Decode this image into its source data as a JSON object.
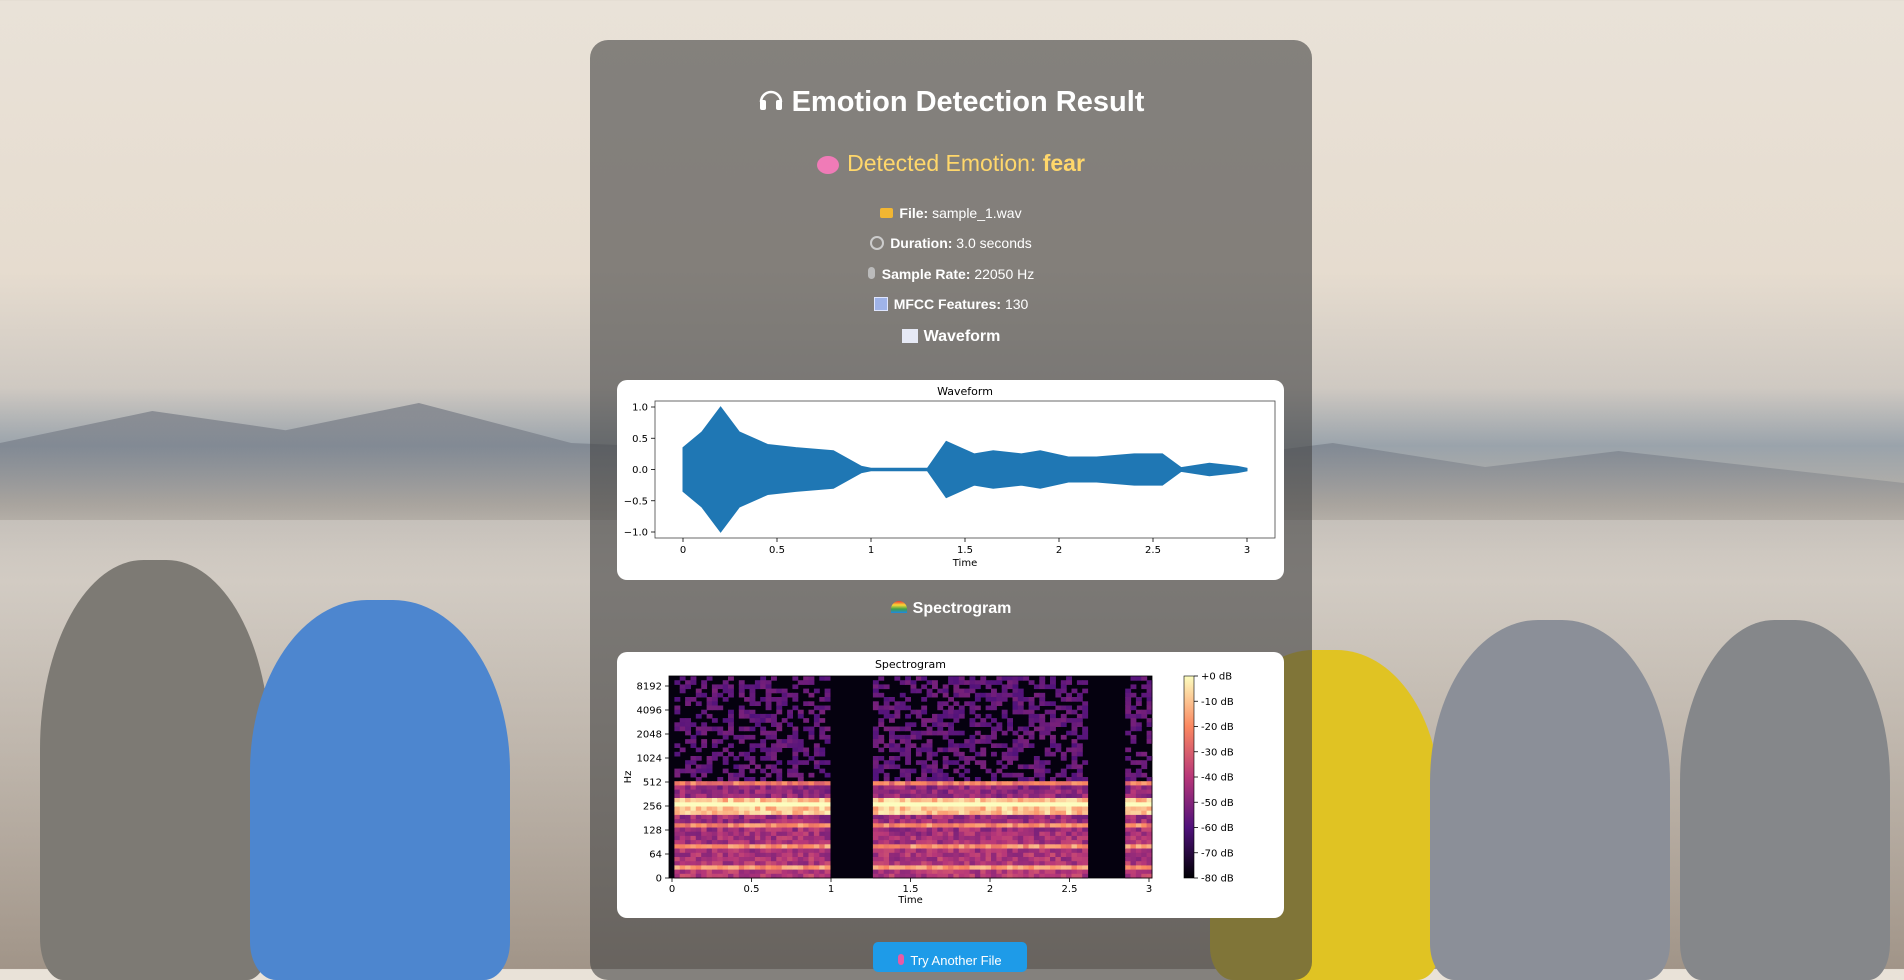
{
  "title": "Emotion Detection Result",
  "emotion": {
    "label": "Detected Emotion:",
    "value": "fear"
  },
  "file": {
    "label": "File:",
    "value": "sample_1.wav"
  },
  "duration": {
    "label": "Duration:",
    "value": "3.0 seconds"
  },
  "sample_rate": {
    "label": "Sample Rate:",
    "value": "22050 Hz"
  },
  "mfcc": {
    "label": "MFCC Features:",
    "value": "130"
  },
  "waveform_heading": "Waveform",
  "spectrogram_heading": "Spectrogram",
  "button_label": "Try Another File",
  "icons": {
    "title": "headphones-icon",
    "emotion": "brain-icon",
    "file": "folder-icon",
    "duration": "stopwatch-icon",
    "sample_rate": "microphone-icon",
    "mfcc": "grid-icon",
    "waveform": "chart-icon",
    "spectrogram": "rainbow-icon",
    "button": "microphone-icon"
  },
  "colors": {
    "accent": "#ffd76b",
    "button": "#1e9be8",
    "waveform": "#1f77b4"
  },
  "chart_data": [
    {
      "type": "line",
      "title": "Waveform",
      "xlabel": "Time",
      "ylabel": "",
      "xlim": [
        0,
        3
      ],
      "ylim": [
        -1.0,
        1.0
      ],
      "x_ticks": [
        "0",
        "0.5",
        "1",
        "1.5",
        "2",
        "2.5",
        "3"
      ],
      "y_ticks": [
        "1.0",
        "0.5",
        "0.0",
        "−0.5",
        "−1.0"
      ],
      "series": [
        {
          "values": [
            {
              "x": 0.0,
              "y": 0.35
            },
            {
              "x": 0.1,
              "y": 0.6
            },
            {
              "x": 0.2,
              "y": 1.0
            },
            {
              "x": 0.3,
              "y": 0.6
            },
            {
              "x": 0.45,
              "y": 0.4
            },
            {
              "x": 0.6,
              "y": 0.35
            },
            {
              "x": 0.8,
              "y": 0.3
            },
            {
              "x": 0.95,
              "y": 0.05
            },
            {
              "x": 1.0,
              "y": 0.02
            },
            {
              "x": 1.3,
              "y": 0.02
            },
            {
              "x": 1.4,
              "y": 0.45
            },
            {
              "x": 1.55,
              "y": 0.25
            },
            {
              "x": 1.65,
              "y": 0.3
            },
            {
              "x": 1.8,
              "y": 0.25
            },
            {
              "x": 1.9,
              "y": 0.3
            },
            {
              "x": 2.05,
              "y": 0.2
            },
            {
              "x": 2.2,
              "y": 0.2
            },
            {
              "x": 2.4,
              "y": 0.25
            },
            {
              "x": 2.55,
              "y": 0.25
            },
            {
              "x": 2.65,
              "y": 0.03
            },
            {
              "x": 2.8,
              "y": 0.1
            },
            {
              "x": 2.95,
              "y": 0.05
            },
            {
              "x": 3.0,
              "y": 0.02
            }
          ]
        }
      ]
    },
    {
      "type": "heatmap",
      "title": "Spectrogram",
      "xlabel": "Time",
      "ylabel": "Hz",
      "xlim": [
        0,
        3
      ],
      "x_ticks": [
        "0",
        "0.5",
        "1",
        "1.5",
        "2",
        "2.5",
        "3"
      ],
      "y_ticks": [
        "8192",
        "4096",
        "2048",
        "1024",
        "512",
        "256",
        "128",
        "64",
        "0"
      ],
      "colorbar_ticks": [
        "+0 dB",
        "-10 dB",
        "-20 dB",
        "-30 dB",
        "-40 dB",
        "-50 dB",
        "-60 dB",
        "-70 dB",
        "-80 dB"
      ],
      "colorbar_range": [
        -80,
        0
      ],
      "grid": false
    }
  ]
}
